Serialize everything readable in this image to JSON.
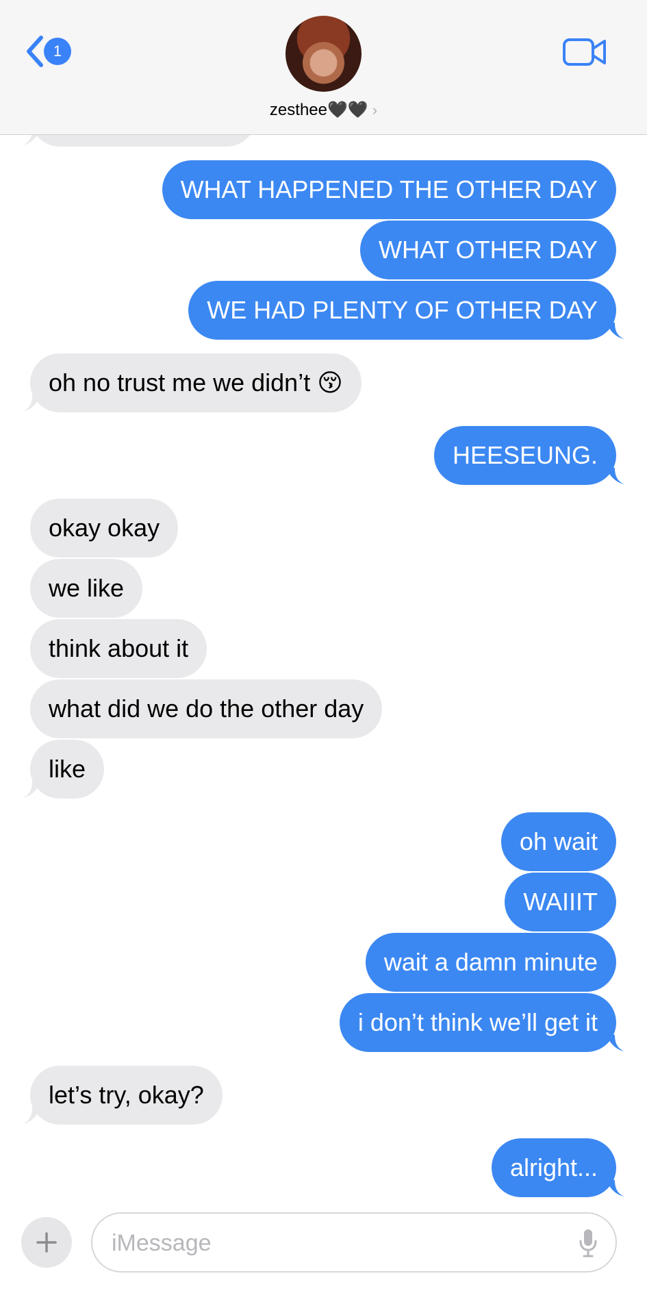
{
  "header": {
    "back_badge": "1",
    "contact_name": "zesthee🖤🖤",
    "chevron": "›"
  },
  "icons": {
    "back": "chevron-left-icon",
    "video": "video-camera-icon",
    "plus": "plus-icon",
    "mic": "microphone-icon"
  },
  "colors": {
    "outgoing_bubble": "#3c88f2",
    "incoming_bubble": "#e9e9eb",
    "accent": "#3a82f7"
  },
  "messages": [
    {
      "dir": "out",
      "text": "WHAT HAPPENED THE OTHER DAY"
    },
    {
      "dir": "out",
      "text": "WHAT OTHER DAY"
    },
    {
      "dir": "out",
      "text": "WE HAD PLENTY OF OTHER DAY"
    },
    {
      "dir": "in",
      "text": "oh no trust me we didn’t 😚"
    },
    {
      "dir": "out",
      "text": "HEESEUNG."
    },
    {
      "dir": "in",
      "text": "okay okay"
    },
    {
      "dir": "in",
      "text": "we like"
    },
    {
      "dir": "in",
      "text": "think about it"
    },
    {
      "dir": "in",
      "text": "what did we do the other day"
    },
    {
      "dir": "in",
      "text": "like"
    },
    {
      "dir": "out",
      "text": "oh wait"
    },
    {
      "dir": "out",
      "text": "WAIIIT"
    },
    {
      "dir": "out",
      "text": "wait a damn minute"
    },
    {
      "dir": "out",
      "text": "i don’t think we’ll get it"
    },
    {
      "dir": "in",
      "text": "let’s try, okay?"
    },
    {
      "dir": "out",
      "text": "alright..."
    }
  ],
  "composer": {
    "placeholder": "iMessage",
    "value": ""
  }
}
